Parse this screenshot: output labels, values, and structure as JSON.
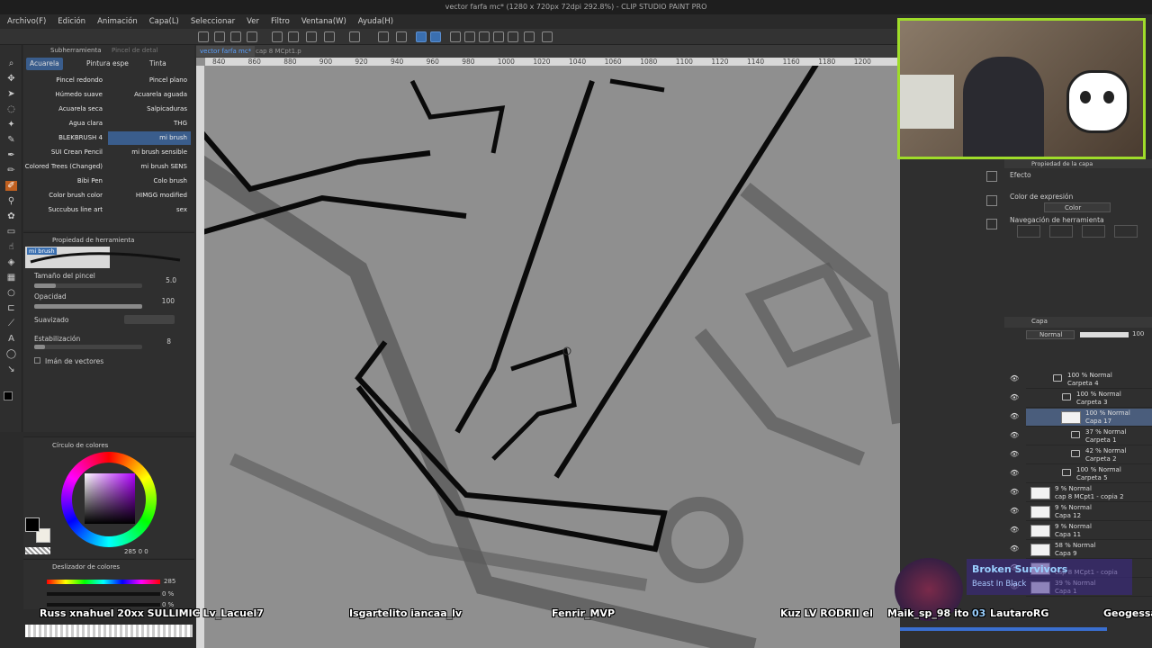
{
  "window": {
    "title": "vector farfa mc* (1280 x 720px 72dpi 292.8%) - CLIP STUDIO PAINT PRO"
  },
  "menu": [
    "Archivo(F)",
    "Edición",
    "Animación",
    "Capa(L)",
    "Seleccionar",
    "Ver",
    "Filtro",
    "Ventana(W)",
    "Ayuda(H)"
  ],
  "doc_tabs": [
    "vector farfa mc*",
    "cap 8 MCpt1.p"
  ],
  "ruler_ticks": [
    "840",
    "860",
    "880",
    "900",
    "920",
    "940",
    "960",
    "980",
    "1000",
    "1020",
    "1040",
    "1060",
    "1080",
    "1100",
    "1120",
    "1140",
    "1160",
    "1180",
    "1200"
  ],
  "subtool": {
    "tabs": [
      "Subherramienta",
      "Pincel de detal"
    ],
    "categories": [
      "Acuarela",
      "Pintura espe",
      "Tinta"
    ],
    "brushes_left": [
      "Pincel redondo",
      "Húmedo suave",
      "Acuarela seca",
      "Agua clara",
      "BLEKBRUSH 4",
      "SUI Crean Pencil",
      "Colored Trees (Changed)",
      "Bibi Pen",
      "Color brush color",
      "Succubus line art"
    ],
    "brushes_right": [
      "Pincel plano",
      "Acuarela aguada",
      "Salpicaduras",
      "THG",
      "mi brush",
      "mi brush sensible",
      "mi brush SENS",
      "Colo brush",
      "HIMGG modified",
      "sex"
    ]
  },
  "tool_property": {
    "title": "Propiedad de herramienta",
    "brush_name": "mi brush",
    "size_label": "Tamaño del pincel",
    "size_value": "5.0",
    "opacity_label": "Opacidad",
    "opacity_value": "100",
    "smooth_label": "Suavizado",
    "stab_label": "Estabilización",
    "stab_value": "8",
    "vector_label": "Imán de vectores"
  },
  "color_wheel": {
    "title": "Círculo de colores",
    "readout": "285  0  0"
  },
  "color_slider": {
    "title": "Deslizador de colores",
    "hue_value": "285",
    "s_value": "0 %",
    "v_value": "0 %"
  },
  "layer_property": {
    "title": "Propiedad de la capa",
    "effect_label": "Efecto",
    "expression_label": "Color de expresión",
    "expression_value": "Color",
    "nav_label": "Navegación de herramienta"
  },
  "layers": {
    "title": "Capa",
    "blend_mode": "Normal",
    "opacity": "100",
    "rows": [
      {
        "pct": "100 % Normal",
        "name": "Carpeta 4",
        "type": "folder"
      },
      {
        "pct": "100 % Normal",
        "name": "Carpeta 3",
        "type": "folder"
      },
      {
        "pct": "100 % Normal",
        "name": "Capa 17",
        "type": "layer",
        "selected": true
      },
      {
        "pct": "37 % Normal",
        "name": "Carpeta 1",
        "type": "folder"
      },
      {
        "pct": "42 % Normal",
        "name": "Carpeta 2",
        "type": "folder"
      },
      {
        "pct": "100 % Normal",
        "name": "Carpeta 5",
        "type": "folder"
      },
      {
        "pct": "9 % Normal",
        "name": "cap 8 MCpt1 - copia 2",
        "type": "layer"
      },
      {
        "pct": "9 % Normal",
        "name": "Capa 12",
        "type": "layer"
      },
      {
        "pct": "9 % Normal",
        "name": "Capa 11",
        "type": "layer"
      },
      {
        "pct": "58 % Normal",
        "name": "Capa 9",
        "type": "layer"
      },
      {
        "pct": "",
        "name": "cap 8 MCpt1 - copia",
        "type": "layer"
      },
      {
        "pct": "39 % Normal",
        "name": "Capa 1",
        "type": "layer"
      }
    ]
  },
  "stream": {
    "alert_title": "Broken Survivors",
    "alert_sub": "Beast In Black",
    "chat_names": [
      "Russ xnahuel 20xx  SULLIMIC Lv_Lacuel7",
      "Isgartelito  iancaa_lv",
      "Fenrir_MVP",
      "Kuz LV RODRII el",
      "Maik_sp_98 ito",
      "LautaroRG",
      "Geogessa"
    ],
    "timer": "03"
  },
  "colors": {
    "accent": "#3a6fb0",
    "frame": "#9fdc2a",
    "canvas_gray": "#8c8c8c"
  }
}
